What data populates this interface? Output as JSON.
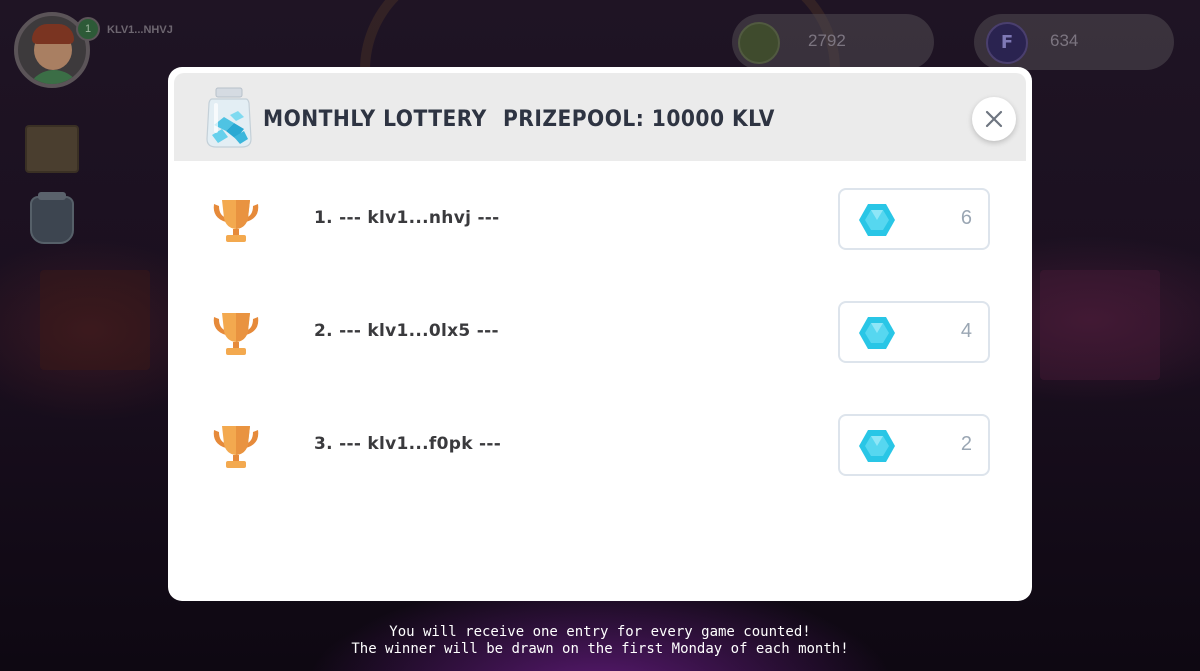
{
  "hud": {
    "level": "1",
    "player_name": "KLV1...NHVJ",
    "currency_1": {
      "icon": "planet-coin-icon",
      "value": "2792"
    },
    "currency_2": {
      "icon": "kfi-token-icon",
      "symbol": "F",
      "value": "634"
    }
  },
  "side_menu": [
    {
      "icon": "scroll-icon"
    },
    {
      "icon": "lottery-jar-icon"
    }
  ],
  "modal": {
    "title": "MONTHLY LOTTERY",
    "prizepool": "PRIZEPOOL: 10000 KLV",
    "close_icon": "close-icon",
    "entries": [
      {
        "label": "1. --- klv1...nhvj ---",
        "count": "6"
      },
      {
        "label": "2. --- klv1...0lx5 ---",
        "count": "4"
      },
      {
        "label": "3. --- klv1...f0pk ---",
        "count": "2"
      }
    ]
  },
  "footer": {
    "line1": "You will receive one entry for every game counted!",
    "line2": "The winner will be drawn on the first Monday of each month!"
  },
  "colors": {
    "title": "#2e3442",
    "trophy_gold": "#f0a24a",
    "gem_cyan": "#29c6e6",
    "count_gray": "#9aa6b3"
  }
}
